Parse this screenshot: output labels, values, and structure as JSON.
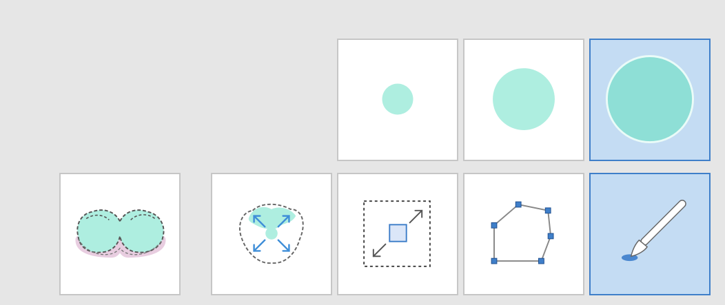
{
  "palette": {
    "brush_sizes": [
      {
        "id": "brush-small",
        "icon": "small-circle-brush-icon",
        "selected": false
      },
      {
        "id": "brush-medium",
        "icon": "medium-circle-brush-icon",
        "selected": false
      },
      {
        "id": "brush-large",
        "icon": "large-circle-brush-icon",
        "selected": true
      }
    ],
    "tools": [
      {
        "id": "tool-teeth",
        "icon": "teeth-outline-icon",
        "selected": false
      },
      {
        "id": "tool-expand",
        "icon": "expand-region-icon",
        "selected": false
      },
      {
        "id": "tool-transform",
        "icon": "scale-transform-icon",
        "selected": false
      },
      {
        "id": "tool-polygon",
        "icon": "polygon-lasso-icon",
        "selected": false
      },
      {
        "id": "tool-paint",
        "icon": "paintbrush-icon",
        "selected": true
      }
    ]
  },
  "colors": {
    "background": "#e6e6e6",
    "tile": "#ffffff",
    "tile_border": "#c6c6c6",
    "selected_fill": "#c4dcf3",
    "selected_border": "#3f7fc9",
    "mint": "#aeeee0",
    "mint_dark": "#8edfd6",
    "gum_pink": "#e8cde0",
    "accent_blue": "#3f7fc9"
  }
}
